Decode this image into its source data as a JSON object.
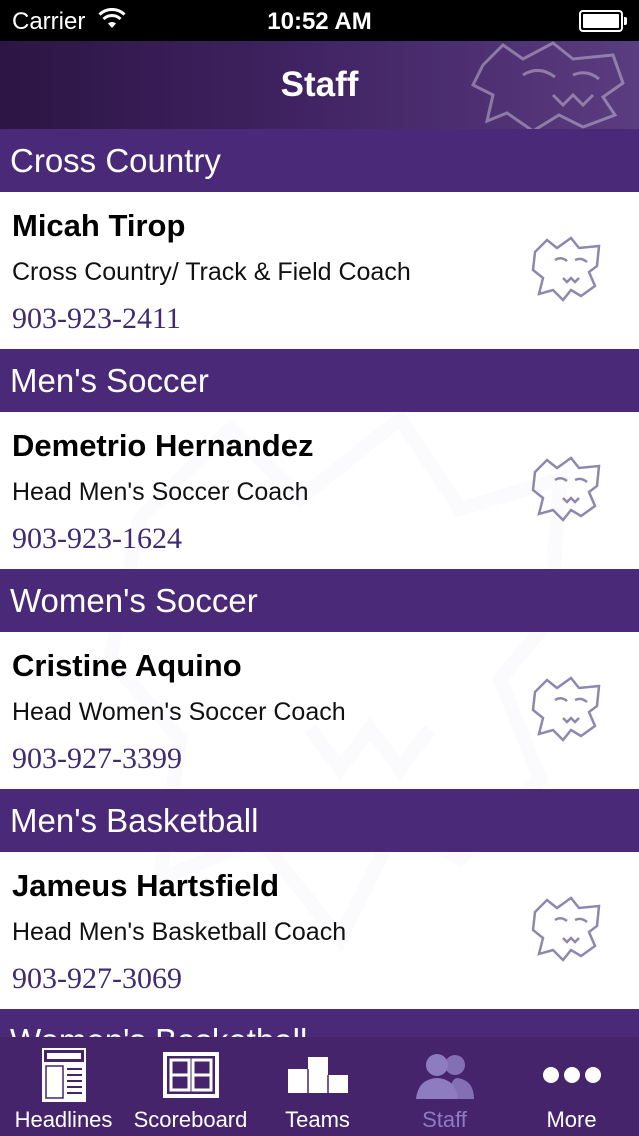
{
  "status_bar": {
    "carrier": "Carrier",
    "time": "10:52 AM"
  },
  "nav": {
    "title": "Staff"
  },
  "sections": [
    {
      "header": "Cross Country",
      "name": "Micah Tirop",
      "role": "Cross Country/ Track & Field Coach",
      "phone": "903-923-2411"
    },
    {
      "header": "Men's Soccer",
      "name": "Demetrio Hernandez",
      "role": "Head Men's Soccer Coach",
      "phone": "903-923-1624"
    },
    {
      "header": "Women's Soccer",
      "name": "Cristine Aquino",
      "role": "Head Women's Soccer Coach",
      "phone": "903-927-3399"
    },
    {
      "header": "Men's Basketball",
      "name": "Jameus Hartsfield",
      "role": "Head Men's Basketball Coach",
      "phone": "903-927-3069"
    },
    {
      "header": "Women's Basketball"
    }
  ],
  "tabs": [
    {
      "label": "Headlines",
      "icon": "newspaper-icon"
    },
    {
      "label": "Scoreboard",
      "icon": "scoreboard-icon"
    },
    {
      "label": "Teams",
      "icon": "podium-icon"
    },
    {
      "label": "Staff",
      "icon": "people-icon",
      "active": true
    },
    {
      "label": "More",
      "icon": "more-dots-icon"
    }
  ],
  "colors": {
    "brand_purple": "#4a2a78",
    "tab_bar": "#45246b",
    "phone_text": "#3f2b73",
    "active_tab": "#8e7cc0"
  }
}
